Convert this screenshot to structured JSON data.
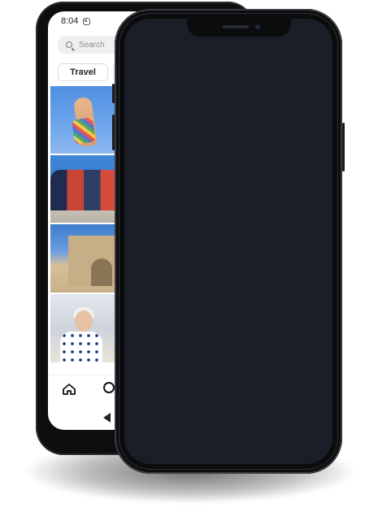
{
  "android": {
    "status_time": "8:04",
    "search_placeholder": "Search",
    "filter_chips": [
      "Travel"
    ]
  }
}
